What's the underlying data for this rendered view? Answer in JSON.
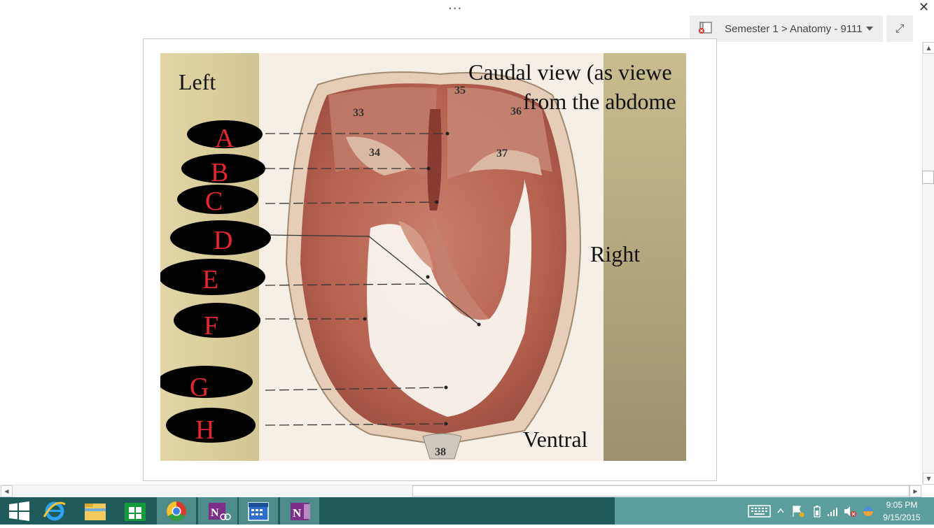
{
  "window": {
    "more_glyph": "···",
    "close_glyph": "✕",
    "expand_glyph": "⤢"
  },
  "notebook": {
    "breadcrumb": "Semester 1 > Anatomy - 9111",
    "icon": "notebook-sync-error-icon"
  },
  "figure": {
    "left_label": "Left",
    "right_label": "Right",
    "ventral_label": "Ventral",
    "caption_line1": "Caudal view (as viewe",
    "caption_line2": "from the abdome",
    "numbers": [
      "33",
      "34",
      "35",
      "36",
      "37",
      "38"
    ],
    "letters": [
      "A",
      "B",
      "C",
      "D",
      "E",
      "F",
      "G",
      "H"
    ]
  },
  "taskbar": {
    "apps": [
      "start-icon",
      "internet-explorer-icon",
      "file-explorer-icon",
      "store-icon",
      "chrome-icon",
      "onenote-clipper-icon",
      "calendar-icon",
      "onenote-icon"
    ],
    "time": "9:05 PM",
    "date": "9/15/2015"
  },
  "colors": {
    "taskbar": "#1f5b5b",
    "tray": "#5c9d9d",
    "annotation_red": "#e8262b",
    "panel_tan": "#ddd0a0",
    "panel_right": "#a89c78"
  }
}
